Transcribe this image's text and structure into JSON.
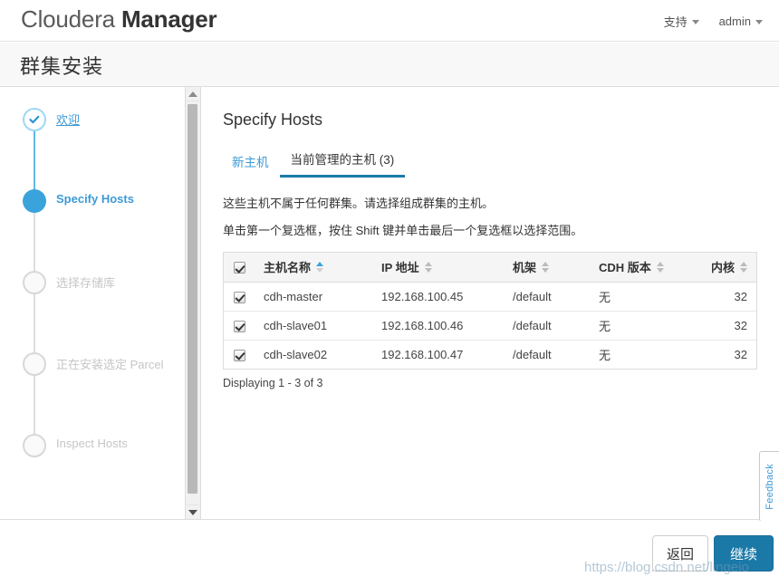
{
  "header": {
    "brand_light": "Cloudera ",
    "brand_bold": "Manager",
    "nav": [
      {
        "label": "支持",
        "icon": "chevron-down-icon"
      },
      {
        "label": "admin",
        "icon": "chevron-down-icon"
      }
    ]
  },
  "page": {
    "title": "群集安装"
  },
  "sidebar": {
    "steps": [
      {
        "label": "欢迎",
        "state": "done"
      },
      {
        "label": "Specify Hosts",
        "state": "active"
      },
      {
        "label": "选择存储库",
        "state": "todo"
      },
      {
        "label": "正在安装选定 Parcel",
        "state": "todo"
      },
      {
        "label": "Inspect Hosts",
        "state": "todo"
      }
    ],
    "scrollbar": {
      "up_icon": "scroll-up-arrow-icon",
      "down_icon": "scroll-down-arrow-icon"
    }
  },
  "main": {
    "heading": "Specify Hosts",
    "tabs": [
      {
        "label": "新主机",
        "active": false
      },
      {
        "label": "当前管理的主机 (3)",
        "active": true
      }
    ],
    "description_line1": "这些主机不属于任何群集。请选择组成群集的主机。",
    "description_line2": "单击第一个复选框，按住 Shift 键并单击最后一个复选框以选择范围。",
    "table": {
      "select_all_checked": true,
      "columns": [
        {
          "label": "主机名称",
          "sort": "asc"
        },
        {
          "label": "IP 地址",
          "sort": "none"
        },
        {
          "label": "机架",
          "sort": "none"
        },
        {
          "label": "CDH 版本",
          "sort": "none"
        },
        {
          "label": "内核",
          "sort": "none"
        }
      ],
      "rows": [
        {
          "checked": true,
          "hostname": "cdh-master",
          "ip": "192.168.100.45",
          "rack": "/default",
          "cdh_version": "无",
          "cores": "32"
        },
        {
          "checked": true,
          "hostname": "cdh-slave01",
          "ip": "192.168.100.46",
          "rack": "/default",
          "cdh_version": "无",
          "cores": "32"
        },
        {
          "checked": true,
          "hostname": "cdh-slave02",
          "ip": "192.168.100.47",
          "rack": "/default",
          "cdh_version": "无",
          "cores": "32"
        }
      ]
    },
    "displaying": "Displaying 1 - 3 of 3"
  },
  "feedback": {
    "label": "Feedback"
  },
  "footer": {
    "back_label": "返回",
    "next_label": "继续"
  },
  "watermark": {
    "text": "https://blog.csdn.net/lingeio"
  },
  "colors": {
    "accent_blue": "#3aa3db",
    "link_blue": "#3c9ad6",
    "tab_underline": "#1b7ba5",
    "primary_button": "#1b79a8",
    "page_title_bg": "#f8f8f8",
    "table_header_bg": "#f5f5f5"
  }
}
